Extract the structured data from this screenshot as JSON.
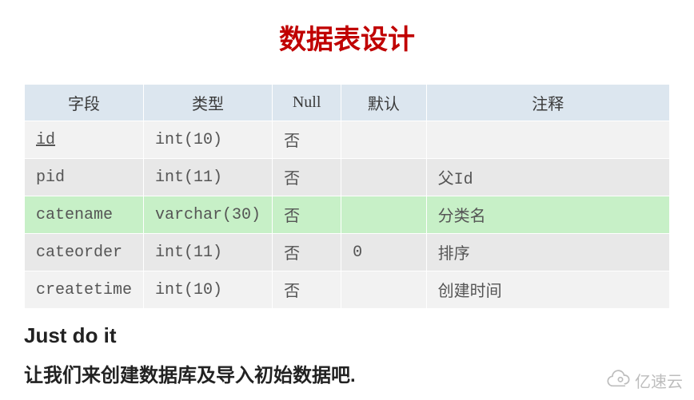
{
  "title": "数据表设计",
  "table": {
    "headers": [
      "字段",
      "类型",
      "Null",
      "默认",
      "注释"
    ],
    "rows": [
      {
        "field": "id",
        "type": "int(10)",
        "null": "否",
        "default": "",
        "comment": "",
        "underline": true,
        "highlight": false
      },
      {
        "field": "pid",
        "type": "int(11)",
        "null": "否",
        "default": "",
        "comment": "父Id",
        "underline": false,
        "highlight": false
      },
      {
        "field": "catename",
        "type": "varchar(30)",
        "null": "否",
        "default": "",
        "comment": "分类名",
        "underline": false,
        "highlight": true
      },
      {
        "field": "cateorder",
        "type": "int(11)",
        "null": "否",
        "default": "0",
        "comment": "排序",
        "underline": false,
        "highlight": false
      },
      {
        "field": "createtime",
        "type": "int(10)",
        "null": "否",
        "default": "",
        "comment": "创建时间",
        "underline": false,
        "highlight": false
      }
    ]
  },
  "subtitle": "Just do it",
  "body_text": "让我们来创建数据库及导入初始数据吧.",
  "watermark": "亿速云"
}
